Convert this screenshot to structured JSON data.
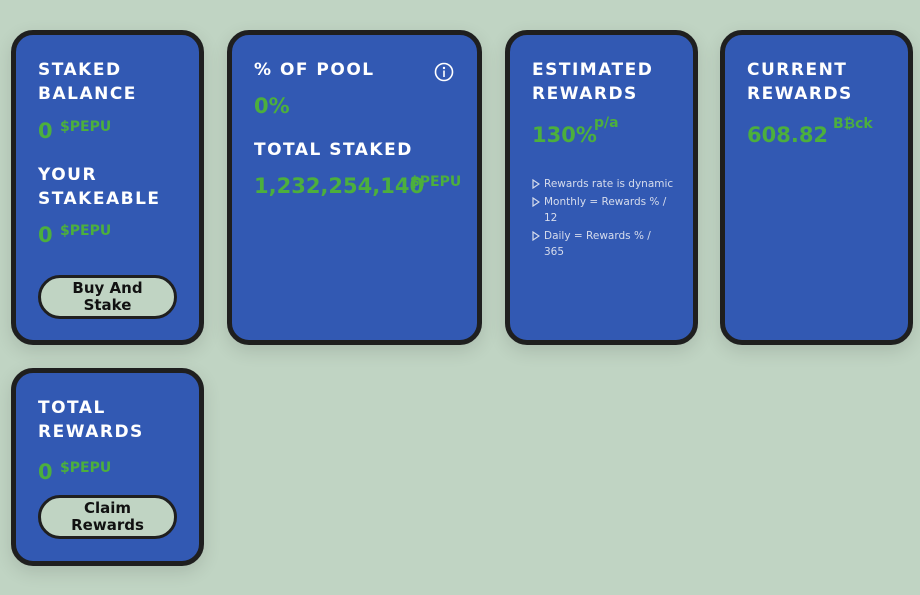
{
  "staked_balance": {
    "label_line1": "STAKED",
    "label_line2": "BALANCE",
    "value": "0",
    "unit": "$PEPU"
  },
  "your_stakeable": {
    "label_line1": "YOUR",
    "label_line2": "STAKEABLE",
    "value": "0",
    "unit": "$PEPU",
    "button_line1": "Buy And",
    "button_line2": "Stake"
  },
  "pool": {
    "label": "% OF POOL",
    "value": "0%",
    "info_icon": "info-icon",
    "total_staked_label": "TOTAL STAKED",
    "total_staked_value": "1,232,254,140",
    "total_staked_unit": "$PEPU"
  },
  "estimated_rewards": {
    "label_line1": "ESTIMATED",
    "label_line2": "REWARDS",
    "value": "130%",
    "unit": "p/a",
    "notes": [
      "Rewards rate is dynamic",
      "Monthly = Rewards % / 12",
      "Daily = Rewards % / 365"
    ]
  },
  "current_rewards": {
    "label_line1": "CURRENT",
    "label_line2": "REWARDS",
    "value": "608.82",
    "unit": "B₿ck"
  },
  "total_rewards": {
    "label_line1": "TOTAL",
    "label_line2": "REWARDS",
    "value": "0",
    "unit": "$PEPU",
    "button_line1": "Claim",
    "button_line2": "Rewards"
  },
  "colors": {
    "page_bg": "#c0d4c3",
    "card_bg": "#3259b3",
    "card_border": "#1f1f1f",
    "accent_green": "#4caf3d",
    "label_white": "#ffffff"
  }
}
